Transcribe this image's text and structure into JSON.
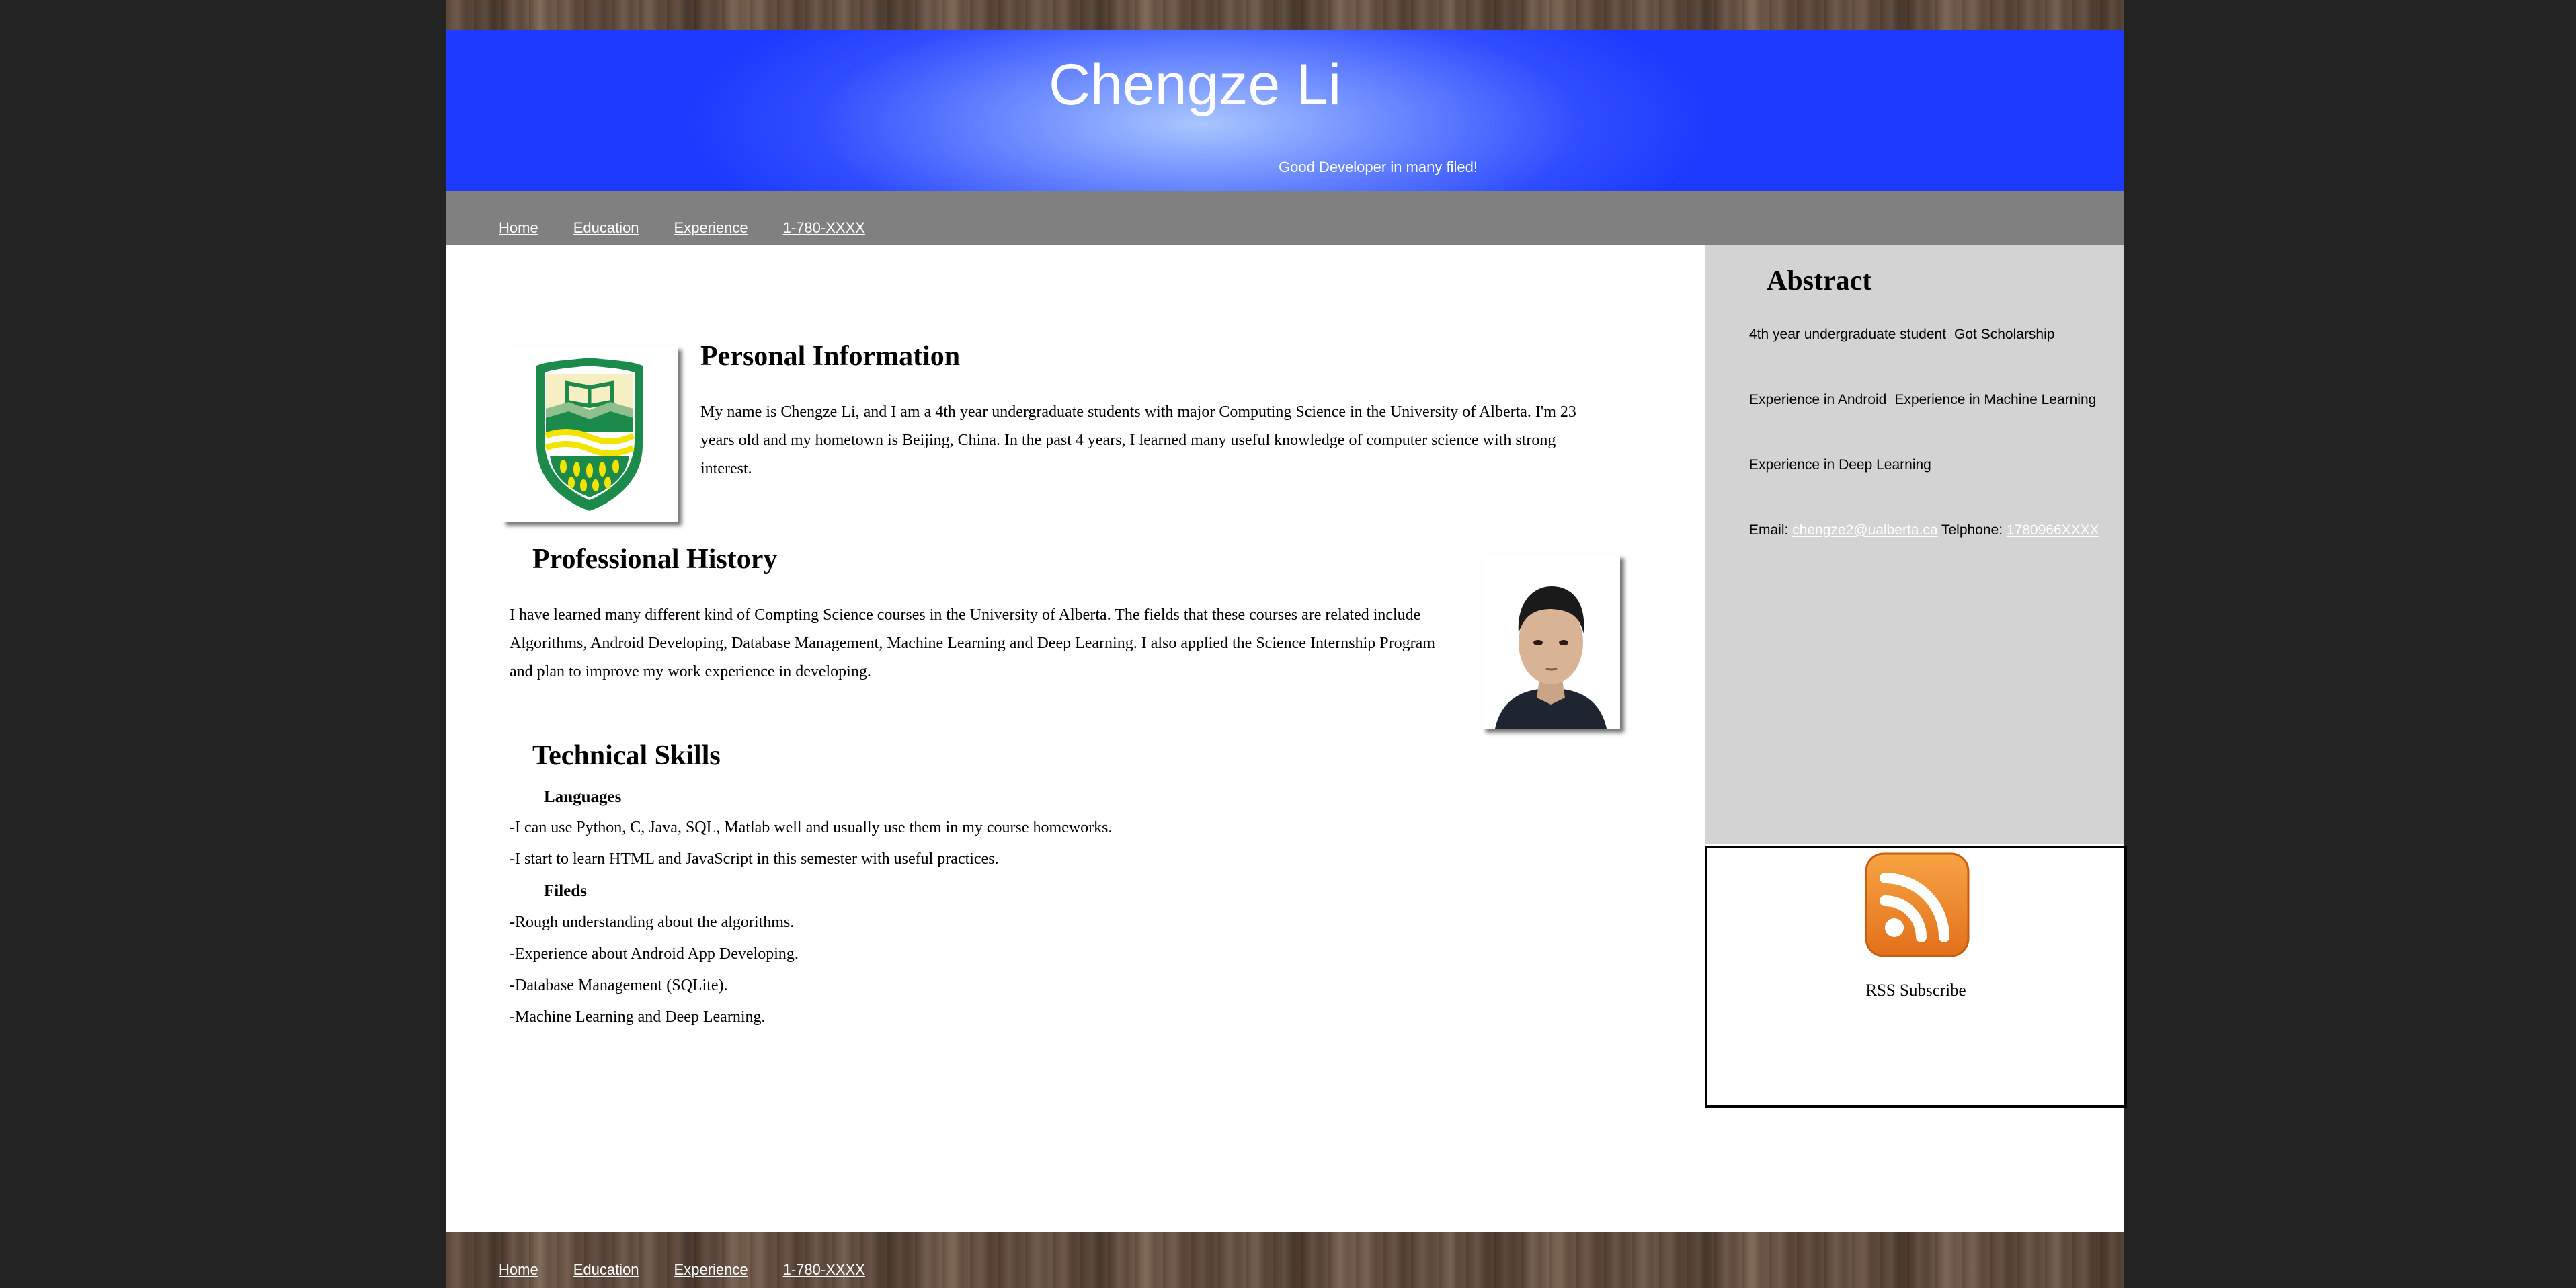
{
  "header": {
    "title": "Chengze Li",
    "tagline": "Good Developer in many filed!"
  },
  "nav": {
    "items": [
      "Home",
      "Education",
      "Experience",
      "1-780-XXXX"
    ]
  },
  "personal": {
    "title": "Personal Information",
    "text": "My name is Chengze Li, and I am a 4th year undergraduate students with major Computing Science in the University of Alberta. I'm 23 years old and my hometown is Beijing, China. In the past 4 years, I learned many useful knowledge of computer science with strong interest."
  },
  "professional": {
    "title": "Professional History",
    "text": "I have learned many different kind of Compting Science courses in the University of Alberta. The fields that these courses are related include Algorithms, Android Developing, Database Management, Machine Learning and Deep Learning. I also applied the Science Internship Program and plan to improve my work experience in developing."
  },
  "skills": {
    "title": "Technical Skills",
    "languages_title": "Languages",
    "languages": [
      "-I can use Python, C, Java, SQL, Matlab well and usually use them in my course homeworks.",
      "-I start to learn HTML and JavaScript in this semester with useful practices."
    ],
    "fields_title": "Fileds",
    "fields": [
      "-Rough understanding about the algorithms.",
      "-Experience about Android App Developing.",
      "-Database Management (SQLite).",
      "-Machine Learning and Deep Learning."
    ]
  },
  "abstract": {
    "title": "Abstract",
    "items": [
      "4th year undergraduate student",
      "Got Scholarship",
      "Experience in Android",
      "Experience in Machine Learning",
      "Experience in Deep Learning"
    ],
    "email_label": "Email:",
    "email": "chengze2@ualberta.ca",
    "phone_label": "Telphone:",
    "phone": "1780966XXXX"
  },
  "rss": {
    "label": "RSS Subscribe"
  },
  "icons": {
    "logo": "university-of-alberta-crest-icon",
    "rss": "rss-feed-icon",
    "photo": "profile-photo"
  },
  "colors": {
    "banner_blue": "#1e3aff",
    "nav_gray": "#808080",
    "sidebar_gray": "#d3d3d3",
    "rss_orange": "#f08a24",
    "crest_green": "#1b8a4a",
    "crest_gold": "#f3e400"
  }
}
